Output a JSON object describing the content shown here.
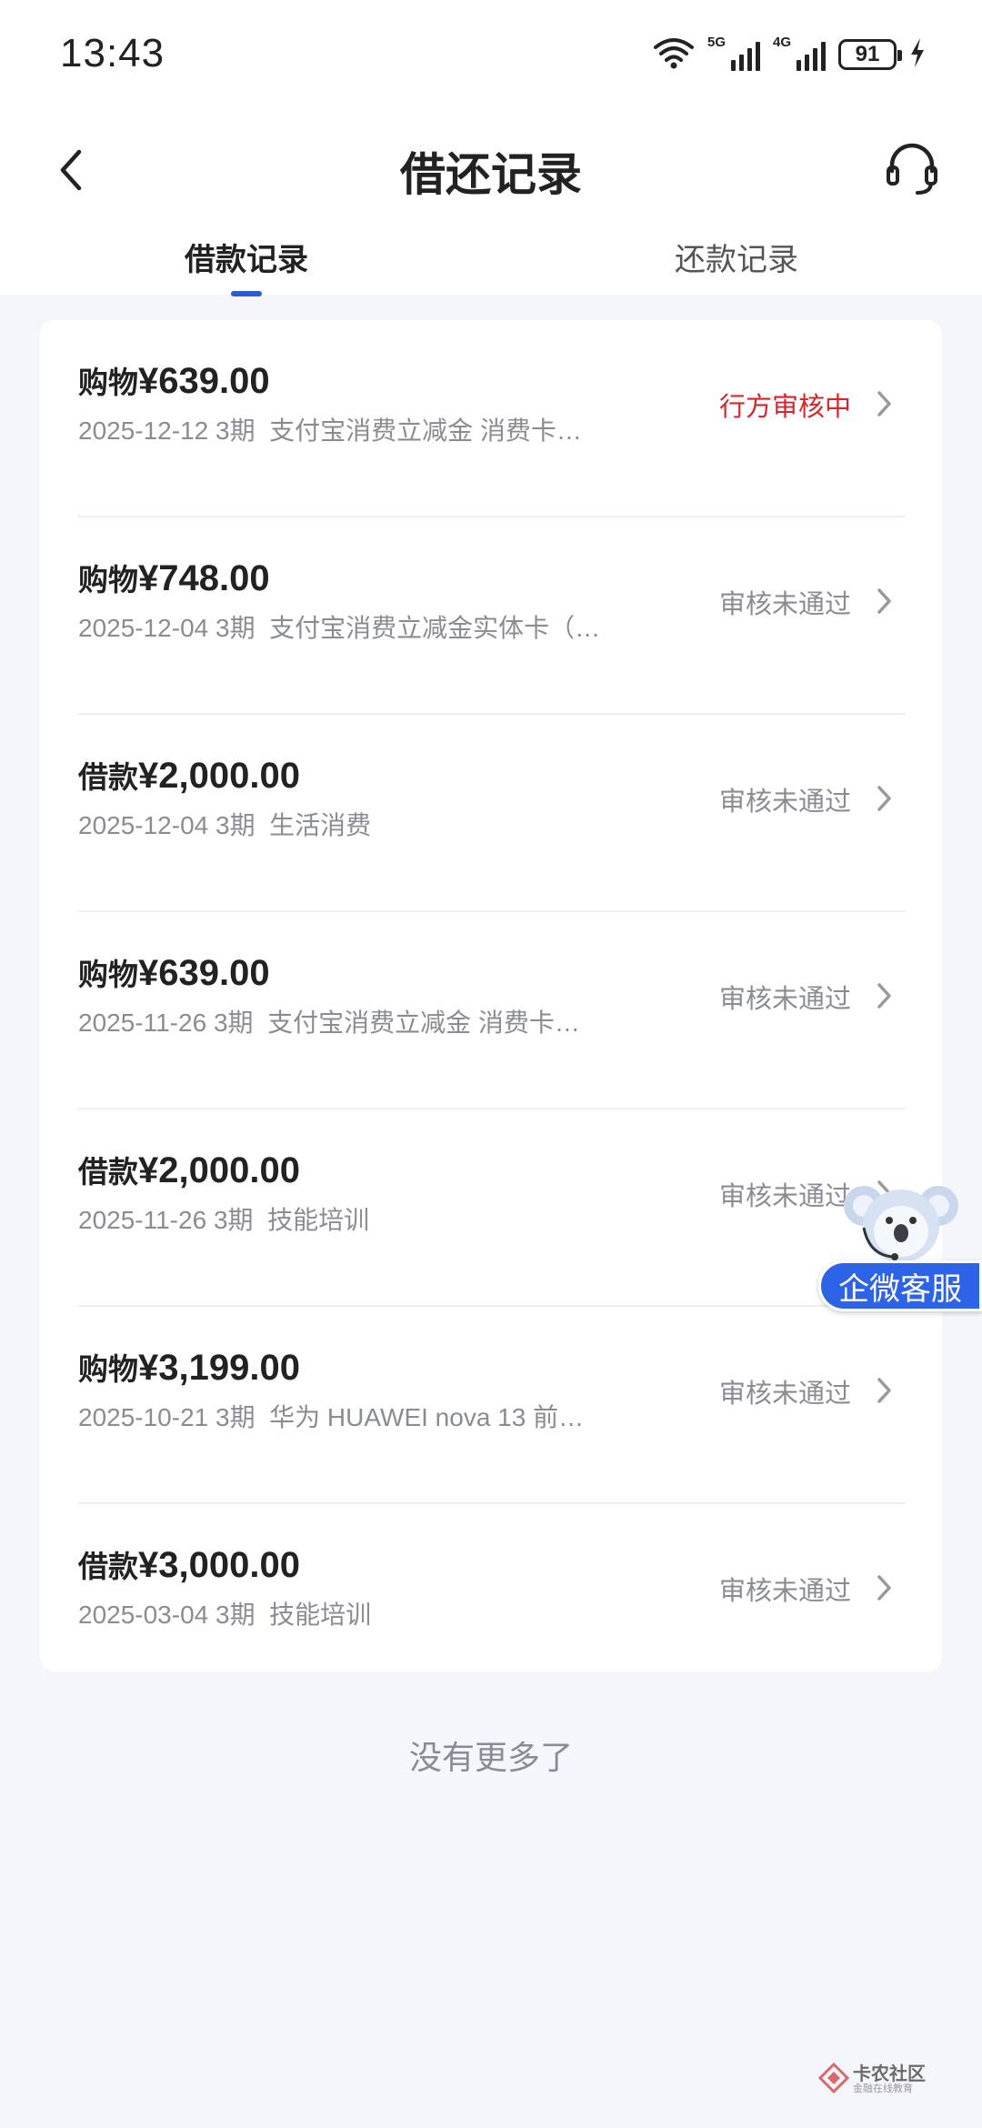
{
  "status_bar": {
    "time": "13:43",
    "network_1": "5G",
    "network_2": "4G",
    "battery": "91",
    "icons": [
      "wifi-icon",
      "signal-5g-icon",
      "signal-4g-icon",
      "battery-icon",
      "charging-icon"
    ]
  },
  "header": {
    "title": "借还记录",
    "back_icon": "chevron-left-icon",
    "service_icon": "headset-icon"
  },
  "tabs": [
    {
      "label": "借款记录",
      "active": true
    },
    {
      "label": "还款记录",
      "active": false
    }
  ],
  "records": [
    {
      "type": "购物",
      "amount": "¥639.00",
      "date": "2025-12-12",
      "term": "3期",
      "desc": "支付宝消费立减金 消费卡…",
      "status": "行方审核中",
      "status_kind": "pending"
    },
    {
      "type": "购物",
      "amount": "¥748.00",
      "date": "2025-12-04",
      "term": "3期",
      "desc": "支付宝消费立减金实体卡（…",
      "status": "审核未通过",
      "status_kind": "rejected"
    },
    {
      "type": "借款",
      "amount": "¥2,000.00",
      "date": "2025-12-04",
      "term": "3期",
      "desc": "生活消费",
      "status": "审核未通过",
      "status_kind": "rejected"
    },
    {
      "type": "购物",
      "amount": "¥639.00",
      "date": "2025-11-26",
      "term": "3期",
      "desc": "支付宝消费立减金 消费卡…",
      "status": "审核未通过",
      "status_kind": "rejected"
    },
    {
      "type": "借款",
      "amount": "¥2,000.00",
      "date": "2025-11-26",
      "term": "3期",
      "desc": "技能培训",
      "status": "审核未通过",
      "status_kind": "rejected"
    },
    {
      "type": "购物",
      "amount": "¥3,199.00",
      "date": "2025-10-21",
      "term": "3期",
      "desc": "华为 HUAWEI nova 13 前…",
      "status": "审核未通过",
      "status_kind": "rejected"
    },
    {
      "type": "借款",
      "amount": "¥3,000.00",
      "date": "2025-03-04",
      "term": "3期",
      "desc": "技能培训",
      "status": "审核未通过",
      "status_kind": "rejected"
    }
  ],
  "footer": {
    "no_more": "没有更多了"
  },
  "float_service": {
    "label": "企微客服"
  },
  "watermark": {
    "title": "卡农社区",
    "subtitle": "金融在线教育"
  },
  "colors": {
    "accent": "#2d5bd7",
    "pending": "#d7262c",
    "muted": "#8a8c93",
    "background": "#f5f6fb"
  }
}
